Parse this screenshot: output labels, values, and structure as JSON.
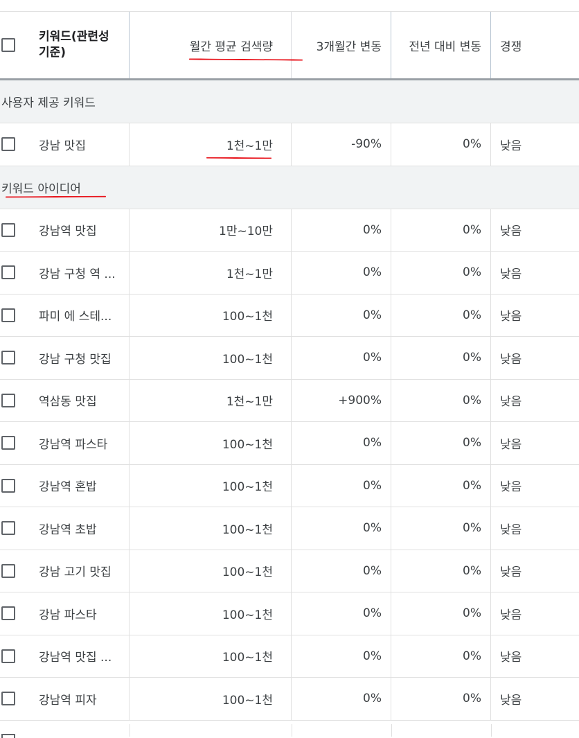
{
  "header": {
    "keyword": "키워드(관련성 기준)",
    "monthly_volume": "월간 평균 검색량",
    "three_month_change": "3개월간 변동",
    "yoy_change": "전년 대비 변동",
    "competition": "경쟁"
  },
  "sections": {
    "provided": "사용자 제공 키워드",
    "ideas": "키워드 아이디어"
  },
  "provided_rows": [
    {
      "keyword": "강남 맛집",
      "volume": "1천~1만",
      "three_month": "-90%",
      "yoy": "0%",
      "competition": "낮음"
    }
  ],
  "idea_rows": [
    {
      "keyword": "강남역 맛집",
      "volume": "1만~10만",
      "three_month": "0%",
      "yoy": "0%",
      "competition": "낮음"
    },
    {
      "keyword": "강남 구청 역 ...",
      "volume": "1천~1만",
      "three_month": "0%",
      "yoy": "0%",
      "competition": "낮음"
    },
    {
      "keyword": "파미 에 스테...",
      "volume": "100~1천",
      "three_month": "0%",
      "yoy": "0%",
      "competition": "낮음"
    },
    {
      "keyword": "강남 구청 맛집",
      "volume": "100~1천",
      "three_month": "0%",
      "yoy": "0%",
      "competition": "낮음"
    },
    {
      "keyword": "역삼동 맛집",
      "volume": "1천~1만",
      "three_month": "+900%",
      "yoy": "0%",
      "competition": "낮음"
    },
    {
      "keyword": "강남역 파스타",
      "volume": "100~1천",
      "three_month": "0%",
      "yoy": "0%",
      "competition": "낮음"
    },
    {
      "keyword": "강남역 혼밥",
      "volume": "100~1천",
      "three_month": "0%",
      "yoy": "0%",
      "competition": "낮음"
    },
    {
      "keyword": "강남역 초밥",
      "volume": "100~1천",
      "three_month": "0%",
      "yoy": "0%",
      "competition": "낮음"
    },
    {
      "keyword": "강남 고기 맛집",
      "volume": "100~1천",
      "three_month": "0%",
      "yoy": "0%",
      "competition": "낮음"
    },
    {
      "keyword": "강남 파스타",
      "volume": "100~1천",
      "three_month": "0%",
      "yoy": "0%",
      "competition": "낮음"
    },
    {
      "keyword": "강남역 맛집 ...",
      "volume": "100~1천",
      "three_month": "0%",
      "yoy": "0%",
      "competition": "낮음"
    },
    {
      "keyword": "강남역 피자",
      "volume": "100~1천",
      "three_month": "0%",
      "yoy": "0%",
      "competition": "낮음"
    }
  ],
  "colors": {
    "annotation": "#e8131b",
    "section_bg": "#f1f3f4",
    "text": "#3c4043"
  }
}
